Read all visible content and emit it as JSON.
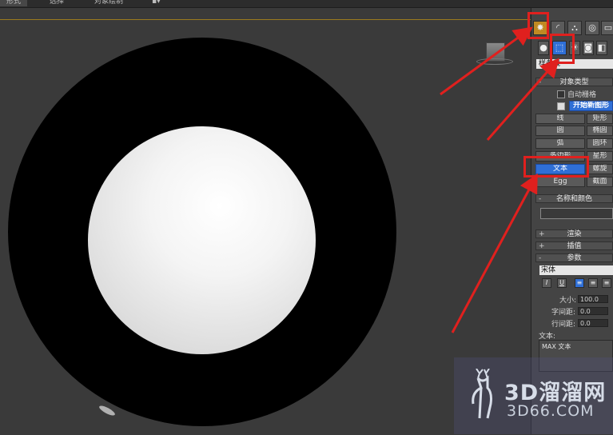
{
  "top_tabs": [
    "形式",
    "选择",
    "对象绘制"
  ],
  "create_panel": {
    "dropdown": "样条线",
    "object_type": {
      "title": "对象类型",
      "auto_grid": "自动栅格",
      "start_new_shape": "开始新图形",
      "buttons": [
        "线",
        "矩形",
        "圆",
        "椭圆",
        "弧",
        "圆环",
        "多边形",
        "星形",
        "文本",
        "螺旋",
        "Egg",
        "截面"
      ]
    },
    "name_color": {
      "title": "名称和颜色",
      "name_value": ""
    },
    "rollouts": {
      "render": "渲染",
      "interpolation": "插值",
      "parameters": "参数"
    },
    "parameters": {
      "font": "宋体",
      "format_buttons": [
        "I",
        "U",
        "≡",
        "≡",
        "≡"
      ],
      "size_label": "大小:",
      "size_value": "100.0",
      "kerning_label": "字间距:",
      "kerning_value": "0.0",
      "leading_label": "行间距:",
      "leading_value": "0.0",
      "text_label": "文本:",
      "text_value": "MAX 文本"
    }
  },
  "watermark": {
    "main": "3D溜溜网",
    "sub": "3D66.COM"
  },
  "colors": {
    "accent_blue": "#2f6fd6",
    "annotation_red": "#e0201e"
  }
}
